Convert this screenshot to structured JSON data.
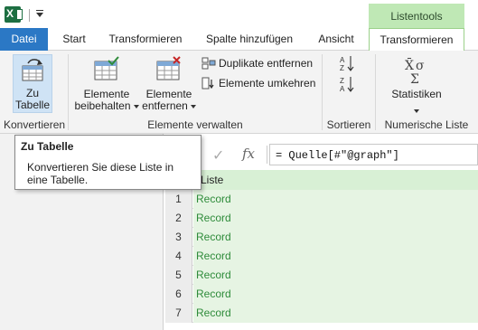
{
  "title_bar": {
    "context_group_label": "Listentools"
  },
  "tabs": [
    {
      "label": "Datei"
    },
    {
      "label": "Start"
    },
    {
      "label": "Transformieren"
    },
    {
      "label": "Spalte hinzufügen"
    },
    {
      "label": "Ansicht"
    },
    {
      "label": "Transformieren"
    }
  ],
  "ribbon": {
    "zu_tabelle": {
      "line1": "Zu",
      "line2": "Tabelle"
    },
    "elemente_beibehalten": {
      "line1": "Elemente",
      "line2": "beibehalten"
    },
    "elemente_entfernen": {
      "line1": "Elemente",
      "line2": "entfernen"
    },
    "duplikate_entfernen": "Duplikate entfernen",
    "elemente_umkehren": "Elemente umkehren",
    "statistiken": "Statistiken",
    "groups": {
      "konvertieren": "Konvertieren",
      "elemente_verwalten": "Elemente verwalten",
      "sortieren": "Sortieren",
      "numerische_liste": "Numerische Liste"
    }
  },
  "formula_bar": {
    "check": "✓",
    "fx": "fx",
    "formula": "= Quelle[#\"@graph\"]"
  },
  "grid": {
    "column_header": "Liste",
    "rows": [
      {
        "num": "1",
        "value": "Record"
      },
      {
        "num": "2",
        "value": "Record"
      },
      {
        "num": "3",
        "value": "Record"
      },
      {
        "num": "4",
        "value": "Record"
      },
      {
        "num": "5",
        "value": "Record"
      },
      {
        "num": "6",
        "value": "Record"
      },
      {
        "num": "7",
        "value": "Record"
      }
    ]
  },
  "tooltip": {
    "title": "Zu Tabelle",
    "body": "Konvertieren Sie diese Liste in eine Tabelle."
  },
  "colors": {
    "file_tab": "#2b78c5",
    "context_green": "#bfe8b5",
    "record_text": "#2e8b3a"
  }
}
